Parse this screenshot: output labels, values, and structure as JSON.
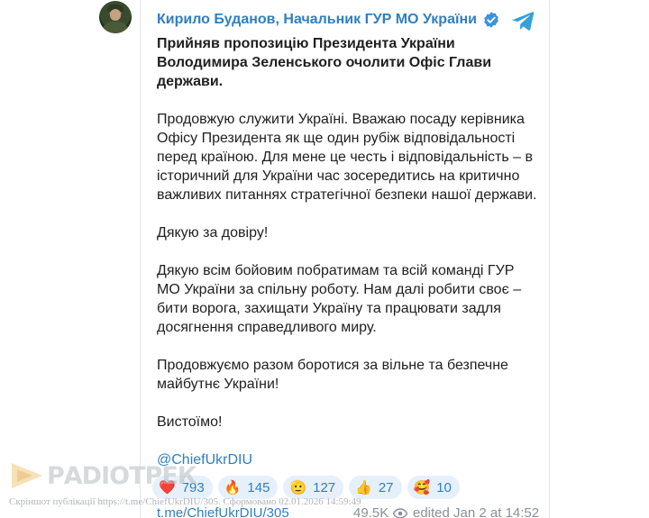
{
  "post": {
    "author": "Кирило Буданов, Начальник ГУР МО України",
    "headline": "Прийняв пропозицію Президента України Володимира Зеленського очолити Офіс Глави держави.",
    "paragraphs": [
      "Продовжую служити Україні. Вважаю посаду керівника Офісу Президента як ще один рубіж відповідальності перед країною. Для мене це честь і відповідальність – в історичний для України час зосередитись на критично важливих питаннях стратегічної безпеки нашої держави.",
      "Дякую за довіру!",
      "Дякую всім бойовим побратимам та всій команді ГУР МО України за спільну роботу. Нам далі робити своє – бити ворога, захищати Україну та працювати задля досягнення справедливого миру.",
      "Продовжуємо разом боротися за вільне та безпечне майбутнє України!",
      "Вистоїмо!"
    ],
    "mention": "@ChiefUkrDIU"
  },
  "reactions": [
    {
      "emoji": "❤️",
      "count": "793"
    },
    {
      "emoji": "🔥",
      "count": "145"
    },
    {
      "emoji": "🫡",
      "count": "127"
    },
    {
      "emoji": "👍",
      "count": "27"
    },
    {
      "emoji": "🥰",
      "count": "10"
    }
  ],
  "footer": {
    "url": "t.me/ChiefUkrDIU/305",
    "views": "49.5K",
    "edited": "edited  Jan 2 at 14:52"
  },
  "watermark": {
    "logo_text": "РАDIOТРЕК",
    "note": "Скріншот публікації https://t.me/ChiefUkrDIU/305. Сформовано 02.01.2026 14:59:49"
  },
  "colors": {
    "accent": "#2f7fc1",
    "reaction_bg": "#e6f0fa",
    "muted": "#8a8f96"
  },
  "icons": [
    "verified-icon",
    "telegram-icon",
    "eye-icon",
    "avatar"
  ]
}
